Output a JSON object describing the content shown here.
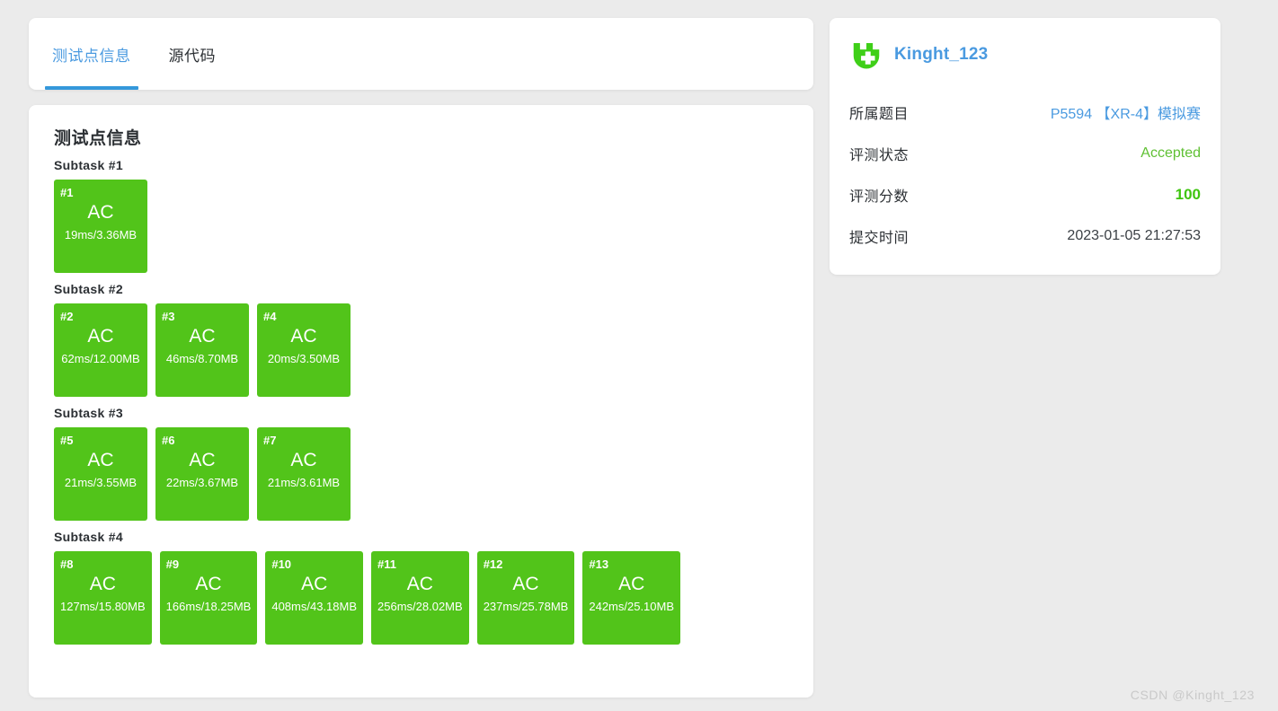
{
  "tabs": [
    {
      "label": "测试点信息",
      "active": true
    },
    {
      "label": "源代码",
      "active": false
    }
  ],
  "main": {
    "section_title": "测试点信息",
    "subtasks": [
      {
        "label": "Subtask #1",
        "testpoints": [
          {
            "id": "#1",
            "status": "AC",
            "meta": "19ms/3.36MB"
          }
        ]
      },
      {
        "label": "Subtask #2",
        "testpoints": [
          {
            "id": "#2",
            "status": "AC",
            "meta": "62ms/12.00MB"
          },
          {
            "id": "#3",
            "status": "AC",
            "meta": "46ms/8.70MB"
          },
          {
            "id": "#4",
            "status": "AC",
            "meta": "20ms/3.50MB"
          }
        ]
      },
      {
        "label": "Subtask #3",
        "testpoints": [
          {
            "id": "#5",
            "status": "AC",
            "meta": "21ms/3.55MB"
          },
          {
            "id": "#6",
            "status": "AC",
            "meta": "22ms/3.67MB"
          },
          {
            "id": "#7",
            "status": "AC",
            "meta": "21ms/3.61MB"
          }
        ]
      },
      {
        "label": "Subtask #4",
        "testpoints": [
          {
            "id": "#8",
            "status": "AC",
            "meta": "127ms/15.80MB"
          },
          {
            "id": "#9",
            "status": "AC",
            "meta": "166ms/18.25MB"
          },
          {
            "id": "#10",
            "status": "AC",
            "meta": "408ms/43.18MB"
          },
          {
            "id": "#11",
            "status": "AC",
            "meta": "256ms/28.02MB"
          },
          {
            "id": "#12",
            "status": "AC",
            "meta": "237ms/25.78MB"
          },
          {
            "id": "#13",
            "status": "AC",
            "meta": "242ms/25.10MB"
          }
        ]
      }
    ]
  },
  "sidebar": {
    "avatar_icon": "green-cross-avatar-icon",
    "username": "Kinght_123",
    "rows": [
      {
        "label": "所属题目",
        "value": "P5594 【XR-4】模拟赛",
        "kind": "link"
      },
      {
        "label": "评测状态",
        "value": "Accepted",
        "kind": "accepted"
      },
      {
        "label": "评测分数",
        "value": "100",
        "kind": "score"
      },
      {
        "label": "提交时间",
        "value": "2023-01-05 21:27:53",
        "kind": "time"
      }
    ]
  },
  "watermark": "CSDN @Kinght_123",
  "colors": {
    "accent_blue": "#3498db",
    "link_blue": "#4a9ae0",
    "accepted_green": "#52c41a",
    "score_green": "#3fc50f",
    "page_bg": "#ebebeb"
  }
}
